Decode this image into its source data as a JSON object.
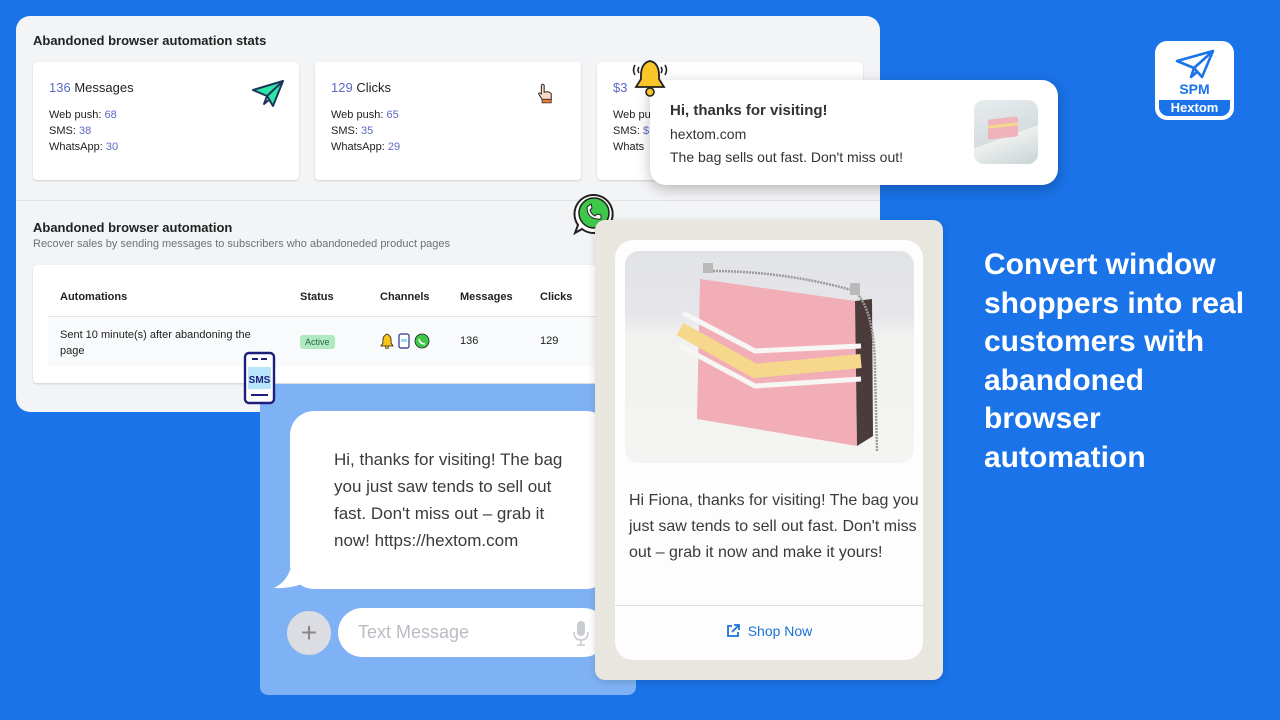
{
  "stats": {
    "title": "Abandoned browser automation stats",
    "cards": [
      {
        "value": "136",
        "label": " Messages",
        "icon": "paper-plane-icon",
        "lines": [
          {
            "label": "Web push: ",
            "value": "68"
          },
          {
            "label": "SMS: ",
            "value": "38"
          },
          {
            "label": "WhatsApp: ",
            "value": "30"
          }
        ]
      },
      {
        "value": "129",
        "label": " Clicks",
        "icon": "hand-pointer-icon",
        "lines": [
          {
            "label": "Web push: ",
            "value": "65"
          },
          {
            "label": "SMS: ",
            "value": "35"
          },
          {
            "label": "WhatsApp: ",
            "value": "29"
          }
        ]
      },
      {
        "value": "$3",
        "label": "",
        "icon": "dollar-icon",
        "lines": [
          {
            "label": "Web pu",
            "value": ""
          },
          {
            "label": "SMS: ",
            "value": "$"
          },
          {
            "label": "Whats",
            "value": ""
          }
        ]
      }
    ]
  },
  "automation": {
    "title": "Abandoned browser automation",
    "subtitle": "Recover sales by sending messages to subscribers who abandoneded product pages",
    "columns": [
      "Automations",
      "Status",
      "Channels",
      "Messages",
      "Clicks"
    ],
    "rows": [
      {
        "automation": "Sent 10 minute(s) after abandoning the page",
        "status": "Active",
        "channels": [
          "bell-icon",
          "sms-phone-icon",
          "whatsapp-icon"
        ],
        "messages": "136",
        "clicks": "129"
      }
    ]
  },
  "push_notification": {
    "title": "Hi, thanks for visiting!",
    "domain": "hextom.com",
    "message": "The bag sells out fast. Don't miss out!"
  },
  "sms": {
    "message": "Hi, thanks for visiting! The bag you just saw tends to sell out fast. Don't miss out – grab it now! https://hextom.com",
    "input_placeholder": "Text Message",
    "plus_label": "+"
  },
  "whatsapp": {
    "message": "Hi Fiona, thanks for visiting! The bag you just saw tends to sell out fast. Don't miss out – grab it now and make it yours!",
    "button_label": "Shop Now"
  },
  "headline": "Convert window shoppers into real customers with abandoned browser automation",
  "logo": {
    "top": "SPM",
    "bottom": "Hextom"
  },
  "colors": {
    "background": "#1a73e8",
    "accent_number": "#5c6ac4",
    "status_active": "#aee9c1",
    "link": "#1d72d2"
  }
}
